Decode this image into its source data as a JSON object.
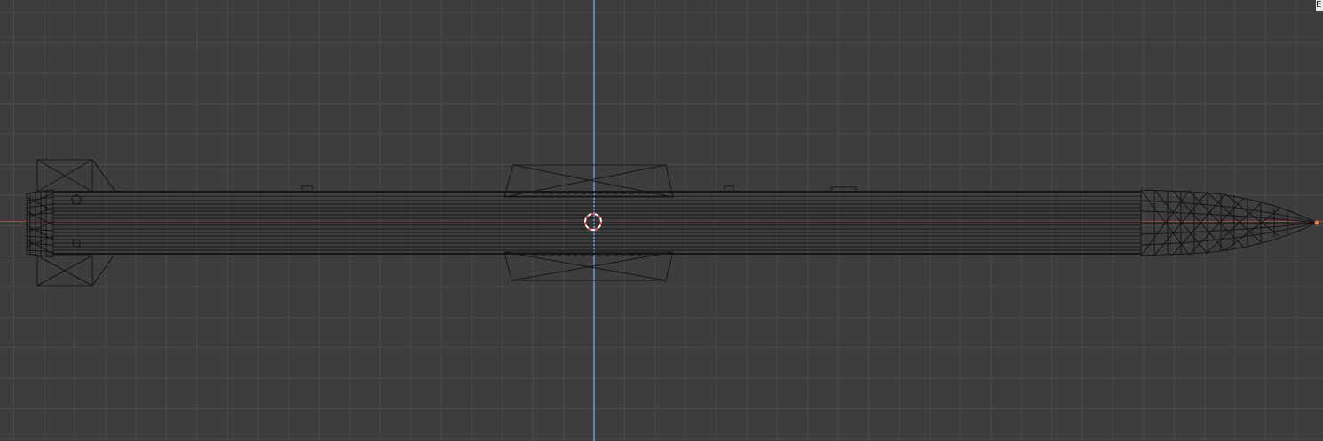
{
  "viewport": {
    "background_color": "#3d3d3d",
    "grid_color": "#4a4a4a",
    "x_axis_color": "#a04a4a",
    "y_axis_color": "#5a84b8",
    "wireframe_color": "#151515",
    "origin_marker_color": "#f07a2a",
    "cursor_colors": [
      "#e04040",
      "#ffffff"
    ],
    "corner_label": "E"
  }
}
